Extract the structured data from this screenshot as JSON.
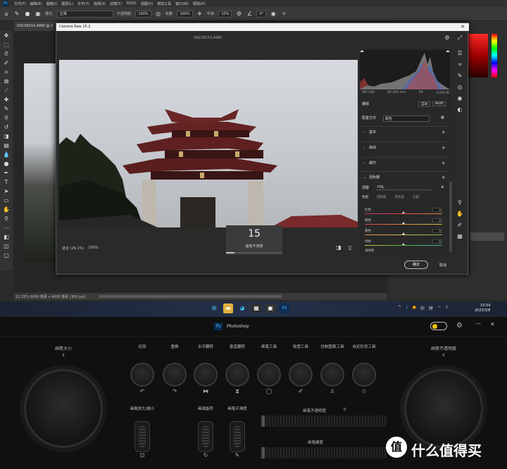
{
  "ps": {
    "menu": [
      "文件(F)",
      "编辑(E)",
      "图像(I)",
      "图层(L)",
      "文字(Y)",
      "选择(S)",
      "滤镜(T)",
      "3D(D)",
      "视图(V)",
      "增效工具",
      "窗口(W)",
      "帮助(H)"
    ],
    "options": {
      "mode_label": "模式:",
      "mode_value": "正常",
      "opacity_label": "不透明度:",
      "opacity_value": "100%",
      "flow_label": "流量:",
      "flow_value": "100%",
      "smooth_label": "平滑:",
      "smooth_value": "10%",
      "angle_value": "0°"
    },
    "doc_tab": "DSC08153.ARW @ 2",
    "status": "22.33%   6000 像素 x 4000 像素 (300 ppi)"
  },
  "acr": {
    "title": "Camera Raw 15.2",
    "filename": "DSC08153.ARW",
    "histo_info": [
      "ISO 100",
      "85-200 mm",
      "f/9",
      "1/320 秒"
    ],
    "edit_label": "编辑",
    "edit_btns": [
      "自动",
      "B&W"
    ],
    "profile_label": "配置文件",
    "profile_value": "颜色",
    "sections": [
      "基本",
      "曲线",
      "细节",
      "混色器"
    ],
    "mixer": {
      "adjust_label": "调整",
      "adjust_value": "HSL",
      "tabs": [
        "色相",
        "饱和度",
        "明亮度",
        "全部"
      ],
      "sliders": [
        {
          "label": "红色",
          "value": "0"
        },
        {
          "label": "橙色",
          "value": "0"
        },
        {
          "label": "黄色",
          "value": "0"
        },
        {
          "label": "绿色",
          "value": "0"
        },
        {
          "label": "浅绿色",
          "value": "0"
        }
      ]
    },
    "zoom_label": "适合 (26.1%)",
    "zoom_pct": "100%",
    "hud": {
      "value": "15",
      "label": "画笔平滑度",
      "level": 0.15
    },
    "ok": "确定",
    "cancel": "取消"
  },
  "taskbar": {
    "tray": [
      "^",
      "中",
      "拼"
    ],
    "time": "10:54",
    "date": "2023/3/8"
  },
  "controller": {
    "app_name": "Photoshop",
    "left_knob": {
      "label": "画笔大小",
      "value": "0"
    },
    "right_knob": {
      "label": "画笔不透明度",
      "value": "0"
    },
    "buttons": [
      "还原",
      "重做",
      "水平翻转",
      "垂直翻转",
      "画笔工具",
      "吸管工具",
      "仿制图章工具",
      "自定形状工具"
    ],
    "wheel_labels": [
      "画面放大/缩小",
      "画面旋转",
      "画笔平滑度"
    ],
    "sliders": [
      {
        "label": "画笔不透明度",
        "value": "0"
      },
      {
        "label": "画笔硬度",
        "value": ""
      }
    ]
  },
  "watermark": {
    "badge": "值",
    "text": "什么值得买"
  }
}
